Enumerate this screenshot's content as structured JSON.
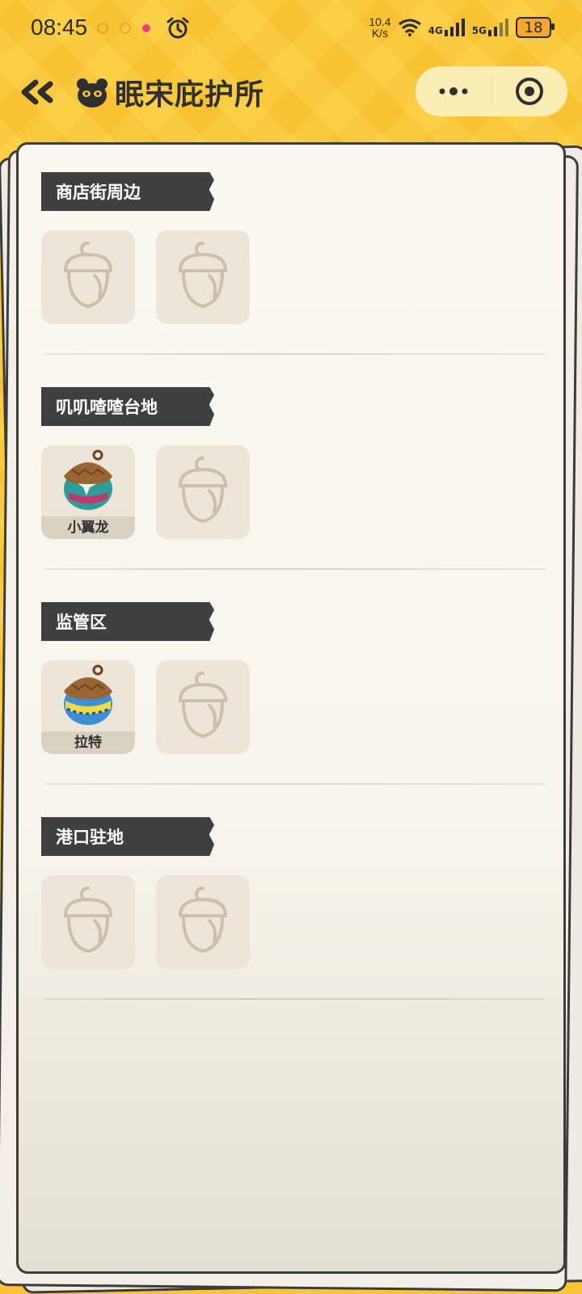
{
  "status_bar": {
    "time": "08:45",
    "net_speed_value": "10.4",
    "net_speed_unit": "K/s",
    "signal_1_label": "4G",
    "signal_2_label": "5G",
    "battery": "18"
  },
  "header": {
    "title": "眠宋庇护所"
  },
  "sections": [
    {
      "title": "商店街周边",
      "slots": [
        {
          "name": ""
        },
        {
          "name": ""
        }
      ]
    },
    {
      "title": "叽叽喳喳台地",
      "slots": [
        {
          "name": "小翼龙"
        },
        {
          "name": ""
        }
      ]
    },
    {
      "title": "监管区",
      "slots": [
        {
          "name": "拉特"
        },
        {
          "name": ""
        }
      ]
    },
    {
      "title": "港口驻地",
      "slots": [
        {
          "name": ""
        },
        {
          "name": ""
        }
      ]
    }
  ],
  "colors": {
    "background": "#f8c232",
    "paper": "#faf8f0",
    "section_header": "#3f3f3f",
    "slot": "#ede6d8"
  }
}
